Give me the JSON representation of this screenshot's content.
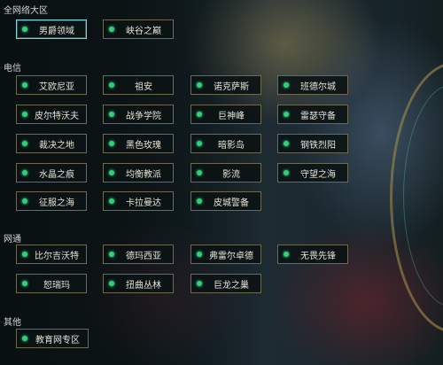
{
  "sections": {
    "quanwang": {
      "title": "全网络大区",
      "items": [
        "男爵领域",
        "峡谷之巅"
      ]
    },
    "dianxin": {
      "title": "电信",
      "items": [
        "艾欧尼亚",
        "祖安",
        "诺克萨斯",
        "班德尔城",
        "皮尔特沃夫",
        "战争学院",
        "巨神峰",
        "雷瑟守备",
        "裁决之地",
        "黑色玫瑰",
        "暗影岛",
        "钢铁烈阳",
        "水晶之痕",
        "均衡教派",
        "影流",
        "守望之海",
        "征服之海",
        "卡拉曼达",
        "皮城警备"
      ]
    },
    "wangtong": {
      "title": "网通",
      "items": [
        "比尔吉沃特",
        "德玛西亚",
        "弗雷尔卓德",
        "无畏先锋",
        "恕瑞玛",
        "扭曲丛林",
        "巨龙之巢"
      ]
    },
    "qita": {
      "title": "其他",
      "items": [
        "教育网专区"
      ]
    }
  },
  "colors": {
    "gem": "#2fd07a",
    "button_border": "#6c6a55",
    "selected_border": "#7fd2d8",
    "text": "#e6e3d6"
  }
}
